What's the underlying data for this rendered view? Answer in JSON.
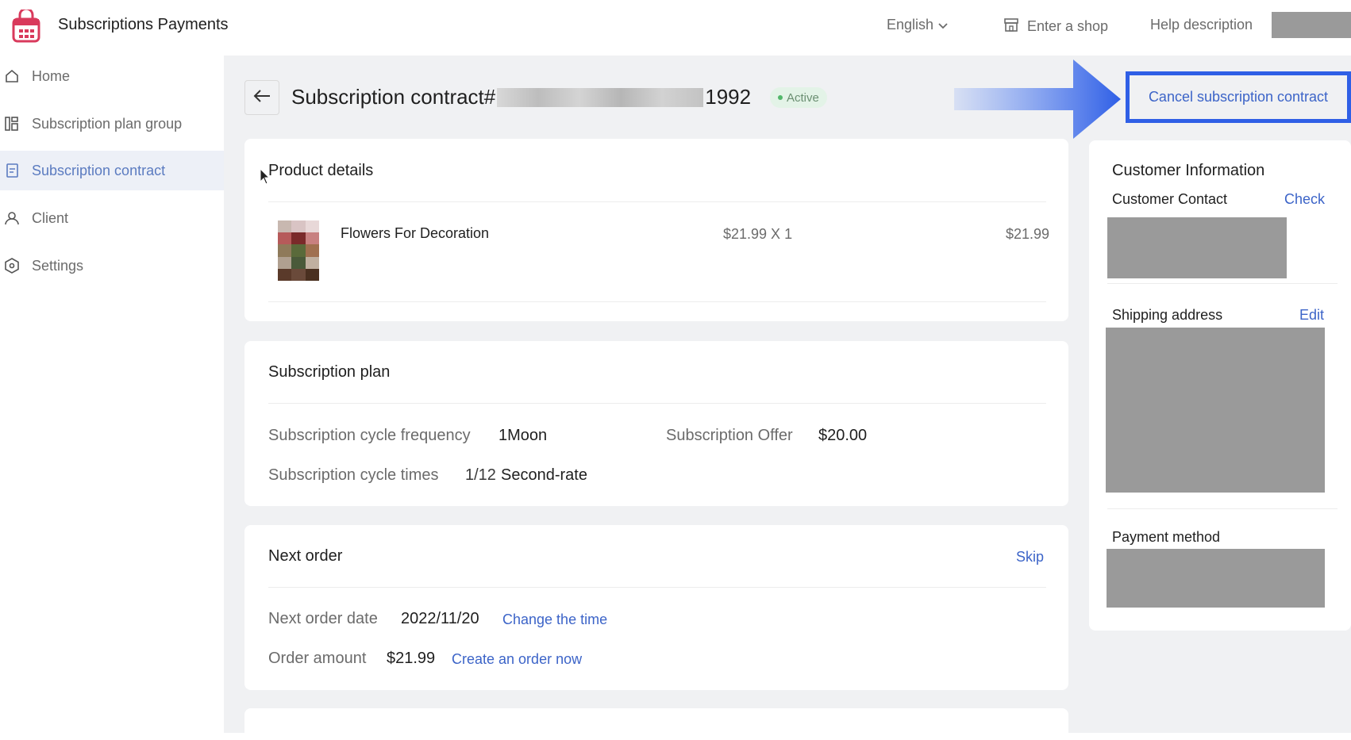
{
  "header": {
    "app_title": "Subscriptions Payments",
    "language": "English",
    "enter_shop": "Enter a shop",
    "help": "Help description"
  },
  "sidebar": {
    "items": [
      {
        "label": "Home",
        "icon": "home-icon",
        "active": false
      },
      {
        "label": "Subscription plan group",
        "icon": "plan-group-icon",
        "active": false
      },
      {
        "label": "Subscription contract",
        "icon": "contract-icon",
        "active": true
      },
      {
        "label": "Client",
        "icon": "user-icon",
        "active": false
      },
      {
        "label": "Settings",
        "icon": "settings-icon",
        "active": false
      }
    ]
  },
  "page": {
    "title_prefix": "Subscription contract#",
    "title_suffix": "1992",
    "status": "Active",
    "cancel_label": "Cancel subscription contract"
  },
  "product_details": {
    "title": "Product details",
    "product_name": "Flowers For Decoration",
    "unit_price_qty": "$21.99 X 1",
    "total": "$21.99"
  },
  "subscription_plan": {
    "title": "Subscription plan",
    "frequency_label": "Subscription cycle frequency",
    "frequency_value": "1Moon",
    "offer_label": "Subscription Offer",
    "offer_value": "$20.00",
    "times_label": "Subscription cycle times",
    "times_value_count": "1/12",
    "times_value_unit": "Second-rate"
  },
  "next_order": {
    "title": "Next order",
    "skip_label": "Skip",
    "date_label": "Next order date",
    "date_value": "2022/11/20",
    "change_time_label": "Change the time",
    "amount_label": "Order amount",
    "amount_value": "$21.99",
    "create_order_label": "Create an order now"
  },
  "customer": {
    "title": "Customer Information",
    "contact_label": "Customer Contact",
    "check_label": "Check",
    "shipping_label": "Shipping address",
    "edit_label": "Edit",
    "payment_label": "Payment method"
  },
  "colors": {
    "accent": "#3c64c8",
    "highlight_border": "#2f5fe6",
    "active_nav_bg": "#edf0f7",
    "status_green": "#52b76a",
    "logo_red": "#d93a5c"
  }
}
